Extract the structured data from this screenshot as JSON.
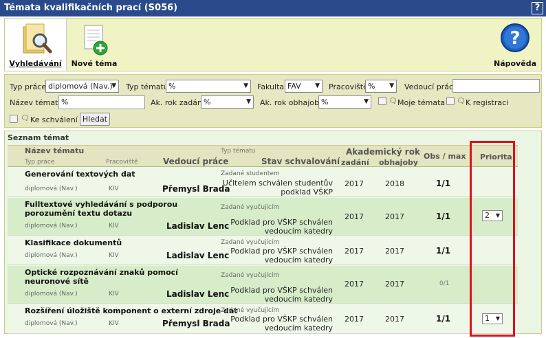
{
  "window": {
    "title": "Témata kvalifikačních prací (S056)",
    "help": "?"
  },
  "toolbar": {
    "search_label": "Vyhledávání",
    "new_topic_label": "Nové téma",
    "help_label": "Nápověda"
  },
  "filters": {
    "typ_prace_label": "Typ práce",
    "typ_prace_value": "diplomová (Nav.)",
    "typ_tematu_label": "Typ tématu",
    "typ_tematu_value": "%",
    "fakulta_label": "Fakulta",
    "fakulta_value": "FAV",
    "pracoviste_label": "Pracoviště",
    "pracoviste_value": "%",
    "vedouci_label": "Vedoucí práce",
    "vedouci_value": "",
    "nazev_label": "Název tématu",
    "nazev_value": "%",
    "rok_zadani_label": "Ak. rok zadání",
    "rok_zadani_value": "%",
    "rok_obhajoby_label": "Ak. rok obhajoby",
    "rok_obhajoby_value": "%",
    "moje_temata_label": "Moje témata",
    "k_registraci_label": "K registraci",
    "ke_schvaleni_label": "Ke schválení",
    "search_button": "Hledat"
  },
  "list": {
    "title": "Seznam témat",
    "headers": {
      "nazev": "Název tématu",
      "typ_prace": "Typ práce",
      "pracoviste": "Pracoviště",
      "vedouci": "Vedoucí práce",
      "typ_tematu": "Typ tématu",
      "stav": "Stav schvalování",
      "ak_rok": "Akademický rok",
      "zadani": "zadání",
      "obhajoby": "obhajoby",
      "obs_max": "Obs / max",
      "priorita": "Priorita"
    },
    "rows": [
      {
        "name": "Generování textových dat",
        "type": "diplomová (Nav.)",
        "dept": "KIV",
        "leader": "Přemysl Brada",
        "topic_type": "Zadané studentem",
        "stav1": "Učitelem schválen studentův",
        "stav2": "podklad VŠKP",
        "zadani": "2017",
        "obhajoby": "2018",
        "obs": "1/1",
        "prio": ""
      },
      {
        "name": "Fulltextové vyhledávání s podporou porozumění textu dotazu",
        "type": "diplomová (Nav.)",
        "dept": "KIV",
        "leader": "Ladislav Lenc",
        "topic_type": "Zadané vyučujícím",
        "stav1": "Podklad pro VŠKP schválen",
        "stav2": "vedoucím katedry",
        "zadani": "2017",
        "obhajoby": "2017",
        "obs": "1/1",
        "prio": "2"
      },
      {
        "name": "Klasifikace dokumentů",
        "type": "diplomová (Nav.)",
        "dept": "KIV",
        "leader": "Ladislav Lenc",
        "topic_type": "Zadané vyučujícím",
        "stav1": "Podklad pro VŠKP schválen",
        "stav2": "vedoucím katedry",
        "zadani": "2017",
        "obhajoby": "2017",
        "obs": "1/1",
        "prio": ""
      },
      {
        "name": "Optické rozpoznávání znaků pomocí neuronové sítě",
        "type": "diplomová (Nav.)",
        "dept": "KIV",
        "leader": "Ladislav Lenc",
        "topic_type": "Zadané vyučujícím",
        "stav1": "Podklad pro VŠKP schválen",
        "stav2": "vedoucím katedry",
        "zadani": "2017",
        "obhajoby": "2017",
        "obs": "0/1",
        "prio": ""
      },
      {
        "name": "Rozšíření úložiště komponent o externí zdroje dat",
        "type": "diplomová (Nav.)",
        "dept": "KIV",
        "leader": "Přemysl Brada",
        "topic_type": "Zadané vyučujícím",
        "stav1": "Podklad pro VŠKP schválen",
        "stav2": "vedoucím katedry",
        "zadani": "2017",
        "obhajoby": "2017",
        "obs": "1/1",
        "prio": "1"
      }
    ]
  }
}
